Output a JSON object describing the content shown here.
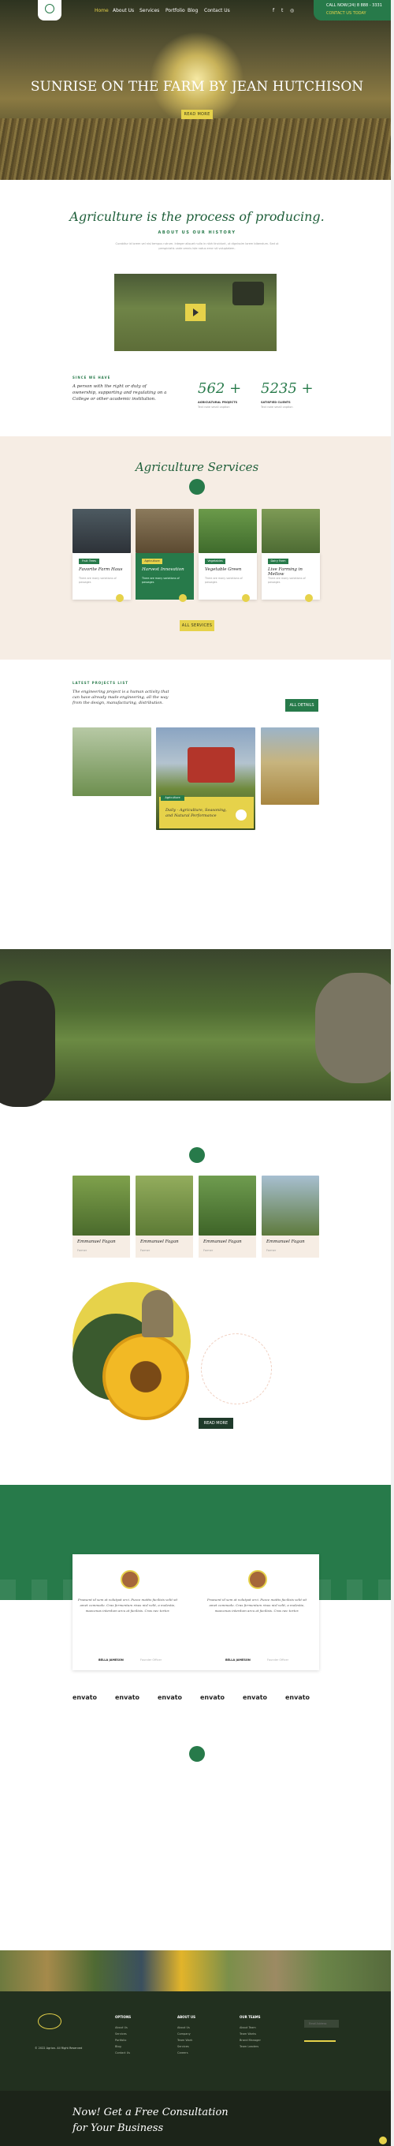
{
  "nav": {
    "items": [
      "Home",
      "About Us",
      "Services",
      "Portfolio",
      "Blog",
      "Contact Us"
    ],
    "call_label": "CALL NOW",
    "phone": "(24) 8 888 - 3331",
    "email": "CONTACT US TODAY"
  },
  "hero": {
    "title": "SUNRISE ON THE FARM BY JEAN HUTCHISON",
    "button": "READ MORE"
  },
  "about": {
    "title": "Agriculture is the process of producing.",
    "subtitle": "ABOUT US OUR HISTORY",
    "text": "Curabitur id lorem vel nisl tempus rutrum. Integer aliquet nulla in nibh tincidunt, ut dignissim lorem bibendum. Sed ut perspiciatis unde omnis iste natus error sit voluptatem.",
    "experience_label": "SINCE WE HAVE",
    "experience_text": "A person with the right or duty of ownership, supporting and regulating on a College or other academic institution.",
    "stat1_value": "562 +",
    "stat1_label": "AGRICULTURAL PROJECTS",
    "stat1_desc": "Text note small caption",
    "stat2_value": "5235 +",
    "stat2_label": "SATISFIED CLIENTS",
    "stat2_desc": "Text note small caption"
  },
  "services": {
    "title": "Agriculture Services",
    "items": [
      {
        "tag": "Fruit Trees",
        "title": "Favorite Farm Haus",
        "desc": "There are many variations of passages"
      },
      {
        "tag": "Agriculture",
        "title": "Harvest Innovation",
        "desc": "There are many variations of passages"
      },
      {
        "tag": "Vegetables",
        "title": "Vegetable Green",
        "desc": "There are many variations of passages"
      },
      {
        "tag": "Dairy Farm",
        "title": "Live Farming in Mellow",
        "desc": "There are many variations of passages"
      }
    ],
    "button": "ALL SERVICES"
  },
  "projects": {
    "label": "LATEST PROJECTS LIST",
    "title": "The engineering project is a human activity that can have already made engineering, all the way from the design, manufacturing, distribution.",
    "button": "ALL DETAILS",
    "featured_tag": "Agriculture",
    "featured_title": "Daily - Agriculture, Seasoning, and Natural Performance"
  },
  "team": {
    "members": [
      {
        "name": "Emmanuel Fagan",
        "role": "Farmer"
      },
      {
        "name": "Emmanuel Fagan",
        "role": "Farmer"
      },
      {
        "name": "Emmanuel Fagan",
        "role": "Farmer"
      },
      {
        "name": "Emmanuel Fagan",
        "role": "Farmer"
      }
    ],
    "button": "READ MORE"
  },
  "testimonials": {
    "items": [
      {
        "quote": "Praesent id sem at volutpat orci. Fusce mattis facilisis velit sit amet commodo. Cras fermentum risus nisl velit, a molestie, maecenas interdum arcu at facilisis. Cras nec tortor.",
        "name": "BELLA JAMESON",
        "role": "Founder Officer"
      },
      {
        "quote": "Praesent id sem at volutpat orci. Fusce mattis facilisis velit sit amet commodo. Cras fermentum risus nisl velit, a molestie, maecenas interdum arcu at facilisis. Cras nec tortor.",
        "name": "BELLA JAMESON",
        "role": "Founder Officer"
      }
    ]
  },
  "partners": [
    "envato",
    "envato",
    "envato",
    "envato",
    "envato",
    "envato"
  ],
  "footer": {
    "col1_title": "OPTIONS",
    "col1_items": [
      "About Us",
      "Services",
      "Portfolio",
      "Blog",
      "Contact Us"
    ],
    "col2_title": "ABOUT US",
    "col2_items": [
      "About Us",
      "Company",
      "Team Work",
      "Services",
      "Careers"
    ],
    "col3_title": "OUR TEAMS",
    "col3_items": [
      "About Team",
      "Team Works",
      "Brand Manager",
      "Team Leaders"
    ],
    "newsletter_placeholder": "Email Address",
    "copyright": "© 2022 Agrion. All Right Reserved",
    "cta_title_1": "Now! Get a Free Consultation",
    "cta_title_2": "for Your Business"
  },
  "colors": {
    "green": "#277a4a",
    "yellow": "#e6d24a",
    "dark": "#22301f",
    "beige": "#f6ede4"
  }
}
